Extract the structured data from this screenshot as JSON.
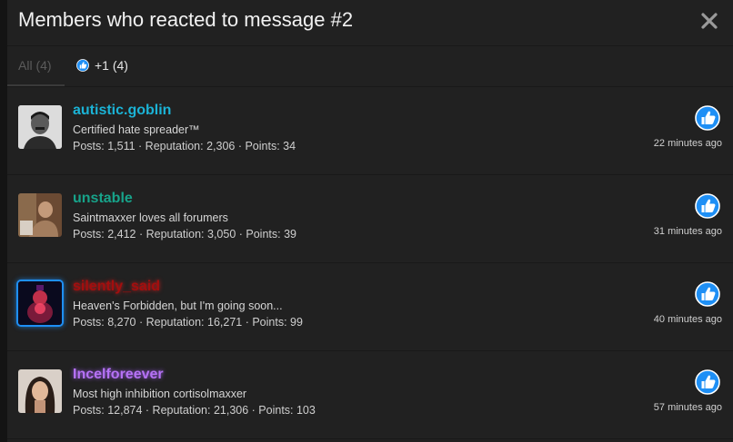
{
  "dialog": {
    "title": "Members who reacted to message #2",
    "close_icon": "close-icon"
  },
  "tabs": [
    {
      "label": "All (4)"
    },
    {
      "label": "+1 (4)",
      "icon": "thumbs-up-icon"
    }
  ],
  "members": [
    {
      "username": "autistic.goblin",
      "user_title": "Certified hate spreader™",
      "stats": "Posts: 1,511 · Reputation: 2,306 · Points: 34",
      "reaction": "thumbs-up-icon",
      "time": "22 minutes ago"
    },
    {
      "username": "unstable",
      "user_title": "Saintmaxxer loves all forumers",
      "stats": "Posts: 2,412 · Reputation: 3,050 · Points: 39",
      "reaction": "thumbs-up-icon",
      "time": "31 minutes ago"
    },
    {
      "username": "silently_said",
      "user_title": "Heaven's Forbidden, but I'm going soon...",
      "stats": "Posts: 8,270 · Reputation: 16,271 · Points: 99",
      "reaction": "thumbs-up-icon",
      "time": "40 minutes ago"
    },
    {
      "username": "Incelforeever",
      "user_title": "Most high inhibition cortisolmaxxer",
      "stats": "Posts: 12,874 · Reputation: 21,306 · Points: 103",
      "reaction": "thumbs-up-icon",
      "time": "57 minutes ago"
    }
  ],
  "colors": {
    "background": "#212121",
    "like_blue": "#1e8ff5",
    "username_0": "#1bb3d6",
    "username_1": "#17a38a",
    "username_2": "#a30e0e",
    "username_3": "#b672f5"
  }
}
